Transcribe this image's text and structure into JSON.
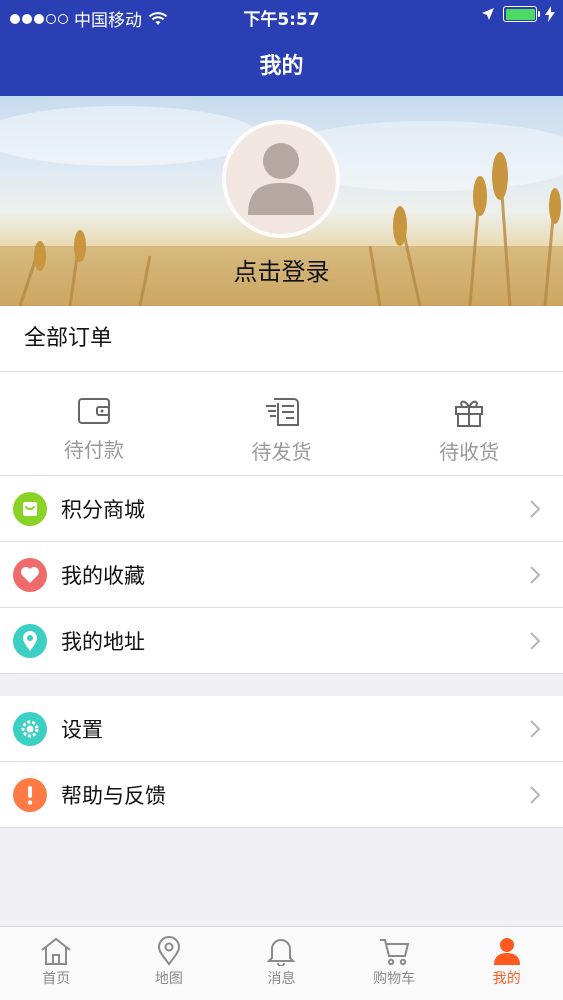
{
  "status_bar": {
    "carrier": "中国移动",
    "time": "下午5:57"
  },
  "nav": {
    "title": "我的"
  },
  "profile": {
    "login_text": "点击登录"
  },
  "orders": {
    "title": "全部订单",
    "items": [
      {
        "label": "待付款",
        "icon": "wallet-icon"
      },
      {
        "label": "待发货",
        "icon": "shipping-doc-icon"
      },
      {
        "label": "待收货",
        "icon": "gift-icon"
      }
    ]
  },
  "menu": {
    "group1": [
      {
        "label": "积分商城",
        "icon": "shopping-bag-icon",
        "color": "#8ad326"
      },
      {
        "label": "我的收藏",
        "icon": "heart-icon",
        "color": "#ef6a6a"
      },
      {
        "label": "我的地址",
        "icon": "location-pin-icon",
        "color": "#3ccfc3"
      }
    ],
    "group2": [
      {
        "label": "设置",
        "icon": "gear-icon",
        "color": "#3ccfc3"
      },
      {
        "label": "帮助与反馈",
        "icon": "exclamation-icon",
        "color": "#ff7a45"
      }
    ]
  },
  "tabbar": {
    "items": [
      {
        "label": "首页",
        "icon": "home-icon"
      },
      {
        "label": "地图",
        "icon": "map-pin-icon"
      },
      {
        "label": "消息",
        "icon": "bell-icon"
      },
      {
        "label": "购物车",
        "icon": "cart-icon"
      },
      {
        "label": "我的",
        "icon": "user-icon",
        "active": true
      }
    ]
  },
  "colors": {
    "nav_bg": "#2b3fb4",
    "active_tab": "#ff5a1f",
    "battery": "#4cd964"
  }
}
